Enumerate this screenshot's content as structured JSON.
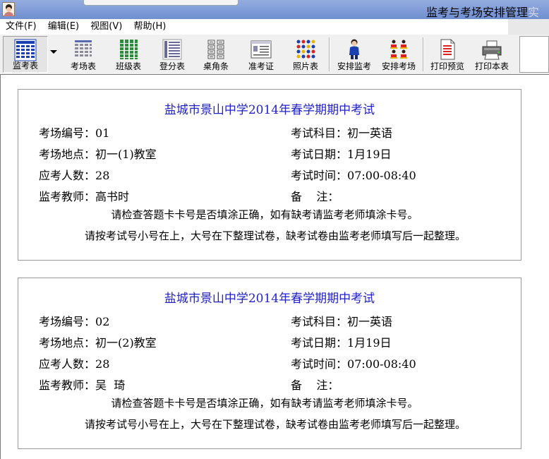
{
  "window": {
    "title": "监考与考场安排管理",
    "title_trailing": "实"
  },
  "menu": [
    {
      "label": "文件(F)"
    },
    {
      "label": "编辑(E)"
    },
    {
      "label": "视图(V)"
    },
    {
      "label": "帮助(H)"
    }
  ],
  "toolbar": {
    "buttons": [
      {
        "label": "监考表",
        "icon": "table-icon"
      },
      {
        "label": "考场表",
        "icon": "table-icon"
      },
      {
        "label": "班级表",
        "icon": "table-icon"
      },
      {
        "label": "登分表",
        "icon": "table-icon"
      },
      {
        "label": "桌角条",
        "icon": "table-icon"
      },
      {
        "label": "准考证",
        "icon": "id-card-icon"
      },
      {
        "label": "照片表",
        "icon": "photo-table-icon"
      },
      {
        "label": "安排监考",
        "icon": "person-icon"
      },
      {
        "label": "安排考场",
        "icon": "people-icon"
      },
      {
        "label": "打印预览",
        "icon": "print-preview-icon"
      },
      {
        "label": "打印本表",
        "icon": "printer-icon"
      }
    ]
  },
  "cards": [
    {
      "title": "盐城市景山中学2014年春学期期中考试",
      "room_no_label": "考场编号：",
      "room_no": "01",
      "subject_label": "考试科目：",
      "subject": "初一英语",
      "location_label": "考场地点：",
      "location": "初一(1)教室",
      "date_label": "考试日期：",
      "date": "1月19日",
      "count_label": "应考人数：",
      "count": "28",
      "time_label": "考试时间：",
      "time": "07:00-08:40",
      "teacher_label": "监考教师：",
      "teacher": "高书时",
      "remark_label": "备    注：",
      "remark": "",
      "note1": "请检查答题卡卡号是否填涂正确，如有缺考请监考老师填涂卡号。",
      "note2": "请按考试号小号在上，大号在下整理试卷，缺考试卷由监考老师填写后一起整理。"
    },
    {
      "title": "盐城市景山中学2014年春学期期中考试",
      "room_no_label": "考场编号：",
      "room_no": "02",
      "subject_label": "考试科目：",
      "subject": "初一英语",
      "location_label": "考场地点：",
      "location": "初一(2)教室",
      "date_label": "考试日期：",
      "date": "1月19日",
      "count_label": "应考人数：",
      "count": "28",
      "time_label": "考试时间：",
      "time": "07:00-08:40",
      "teacher_label": "监考教师：",
      "teacher": "吴  琦",
      "remark_label": "备    注：",
      "remark": "",
      "note1": "请检查答题卡卡号是否填涂正确，如有缺考请监考老师填涂卡号。",
      "note2": "请按考试号小号在上，大号在下整理试卷，缺考试卷由监考老师填写后一起整理。"
    }
  ],
  "colors": {
    "title_bar": "#7f9bd6",
    "card_title": "#2222c8",
    "icon_blue": "#1a3fb0",
    "icon_green": "#2e8b3c"
  }
}
